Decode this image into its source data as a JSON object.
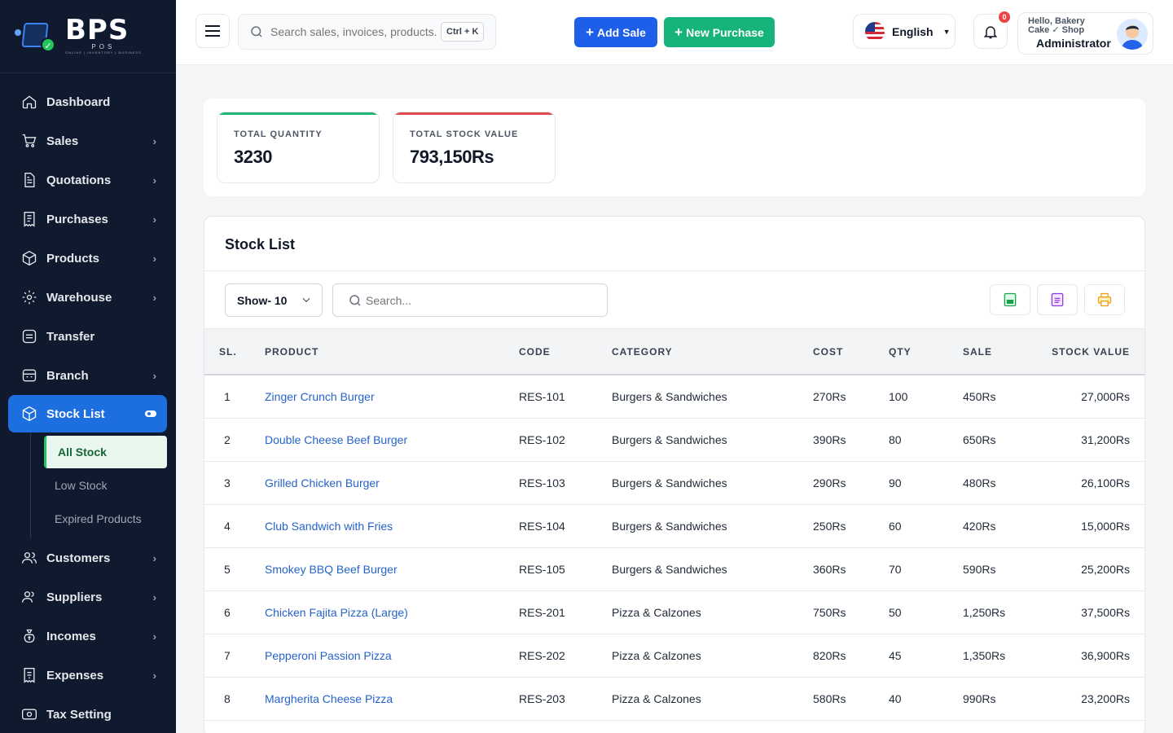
{
  "brand": {
    "name": "BPS",
    "sub": "POS",
    "tagline": "ONLINE | INVENTORY | BUSINESS"
  },
  "sidebar": {
    "items": [
      {
        "label": "Dashboard",
        "icon": "home-icon",
        "chevron": false
      },
      {
        "label": "Sales",
        "icon": "cart-icon",
        "chevron": true
      },
      {
        "label": "Quotations",
        "icon": "document-icon",
        "chevron": true
      },
      {
        "label": "Purchases",
        "icon": "receipt-icon",
        "chevron": true
      },
      {
        "label": "Products",
        "icon": "box-icon",
        "chevron": true
      },
      {
        "label": "Warehouse",
        "icon": "warehouse-icon",
        "chevron": true
      },
      {
        "label": "Transfer",
        "icon": "transfer-icon",
        "chevron": false
      },
      {
        "label": "Branch",
        "icon": "branch-icon",
        "chevron": true
      },
      {
        "label": "Stock List",
        "icon": "stock-icon",
        "chevron": false,
        "active": true
      },
      {
        "label": "Customers",
        "icon": "users-icon",
        "chevron": true
      },
      {
        "label": "Suppliers",
        "icon": "supplier-icon",
        "chevron": true
      },
      {
        "label": "Incomes",
        "icon": "money-bag-icon",
        "chevron": true
      },
      {
        "label": "Expenses",
        "icon": "expense-icon",
        "chevron": true
      },
      {
        "label": "Tax Setting",
        "icon": "tax-icon",
        "chevron": false
      }
    ],
    "stock_sub": [
      "All Stock",
      "Low Stock",
      "Expired Products"
    ]
  },
  "header": {
    "search_placeholder": "Search sales, invoices, products...",
    "shortcut": "Ctrl + K",
    "add_sale": "Add Sale",
    "new_purchase": "New Purchase",
    "language": "English",
    "notifications": "0",
    "greeting": "Hello, Bakery Cake ✓ Shop",
    "role": "Administrator"
  },
  "summary": {
    "total_quantity_label": "TOTAL QUANTITY",
    "total_quantity": "3230",
    "total_value_label": "TOTAL STOCK VALUE",
    "total_value": "793,150Rs"
  },
  "stock": {
    "title": "Stock List",
    "show": "Show- 10",
    "search_placeholder": "Search...",
    "columns": [
      "SL.",
      "PRODUCT",
      "CODE",
      "CATEGORY",
      "COST",
      "QTY",
      "SALE",
      "STOCK VALUE"
    ],
    "rows": [
      [
        "1",
        "Zinger Crunch Burger",
        "RES-101",
        "Burgers & Sandwiches",
        "270Rs",
        "100",
        "450Rs",
        "27,000Rs"
      ],
      [
        "2",
        "Double Cheese Beef Burger",
        "RES-102",
        "Burgers & Sandwiches",
        "390Rs",
        "80",
        "650Rs",
        "31,200Rs"
      ],
      [
        "3",
        "Grilled Chicken Burger",
        "RES-103",
        "Burgers & Sandwiches",
        "290Rs",
        "90",
        "480Rs",
        "26,100Rs"
      ],
      [
        "4",
        "Club Sandwich with Fries",
        "RES-104",
        "Burgers & Sandwiches",
        "250Rs",
        "60",
        "420Rs",
        "15,000Rs"
      ],
      [
        "5",
        "Smokey BBQ Beef Burger",
        "RES-105",
        "Burgers & Sandwiches",
        "360Rs",
        "70",
        "590Rs",
        "25,200Rs"
      ],
      [
        "6",
        "Chicken Fajita Pizza (Large)",
        "RES-201",
        "Pizza & Calzones",
        "750Rs",
        "50",
        "1,250Rs",
        "37,500Rs"
      ],
      [
        "7",
        "Pepperoni Passion Pizza",
        "RES-202",
        "Pizza & Calzones",
        "820Rs",
        "45",
        "1,350Rs",
        "36,900Rs"
      ],
      [
        "8",
        "Margherita Cheese Pizza",
        "RES-203",
        "Pizza & Calzones",
        "580Rs",
        "40",
        "990Rs",
        "23,200Rs"
      ]
    ]
  },
  "colors": {
    "sidebar": "#0f1a2e",
    "primary": "#1d5fe8",
    "success": "#16b47a",
    "danger": "#e34a4a"
  }
}
